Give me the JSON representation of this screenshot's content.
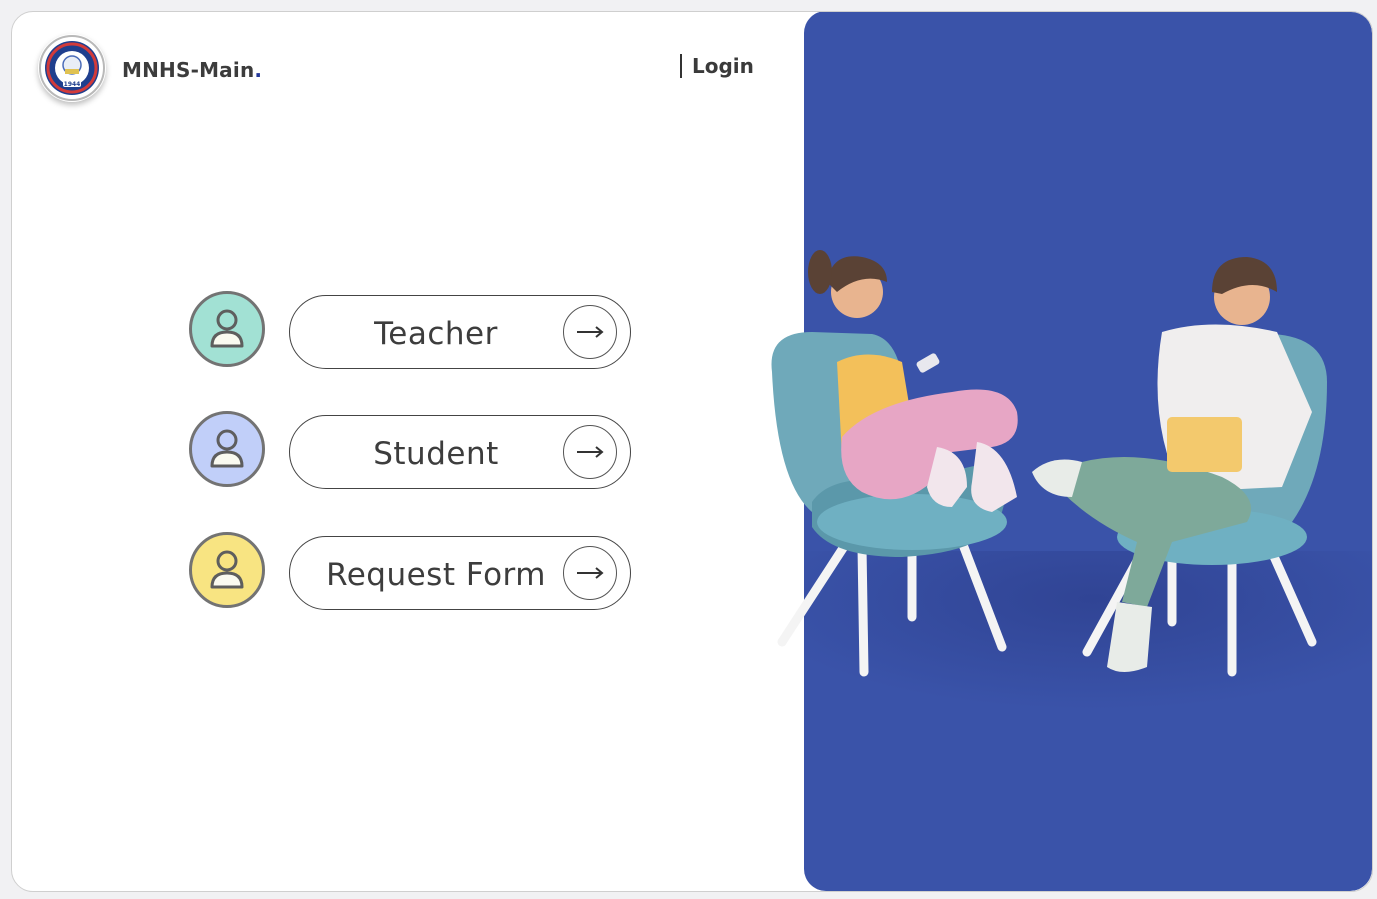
{
  "header": {
    "brand_name": "MNHS-Main",
    "brand_dot": ".",
    "login_label": "Login",
    "logo": {
      "icon": "school-seal-logo",
      "year": "1944"
    }
  },
  "roles": [
    {
      "label": "Teacher",
      "avatar_color": "#a2e1d4",
      "icon": "user-icon",
      "arrow_icon": "arrow-right-icon"
    },
    {
      "label": "Student",
      "avatar_color": "#c1cff9",
      "icon": "user-icon",
      "arrow_icon": "arrow-right-icon"
    },
    {
      "label": "Request Form",
      "avatar_color": "#f8e482",
      "icon": "user-icon",
      "arrow_icon": "arrow-right-icon"
    }
  ],
  "illustration": {
    "description_icon": "students-reading-illustration",
    "panel_color": "#3a53a9"
  }
}
